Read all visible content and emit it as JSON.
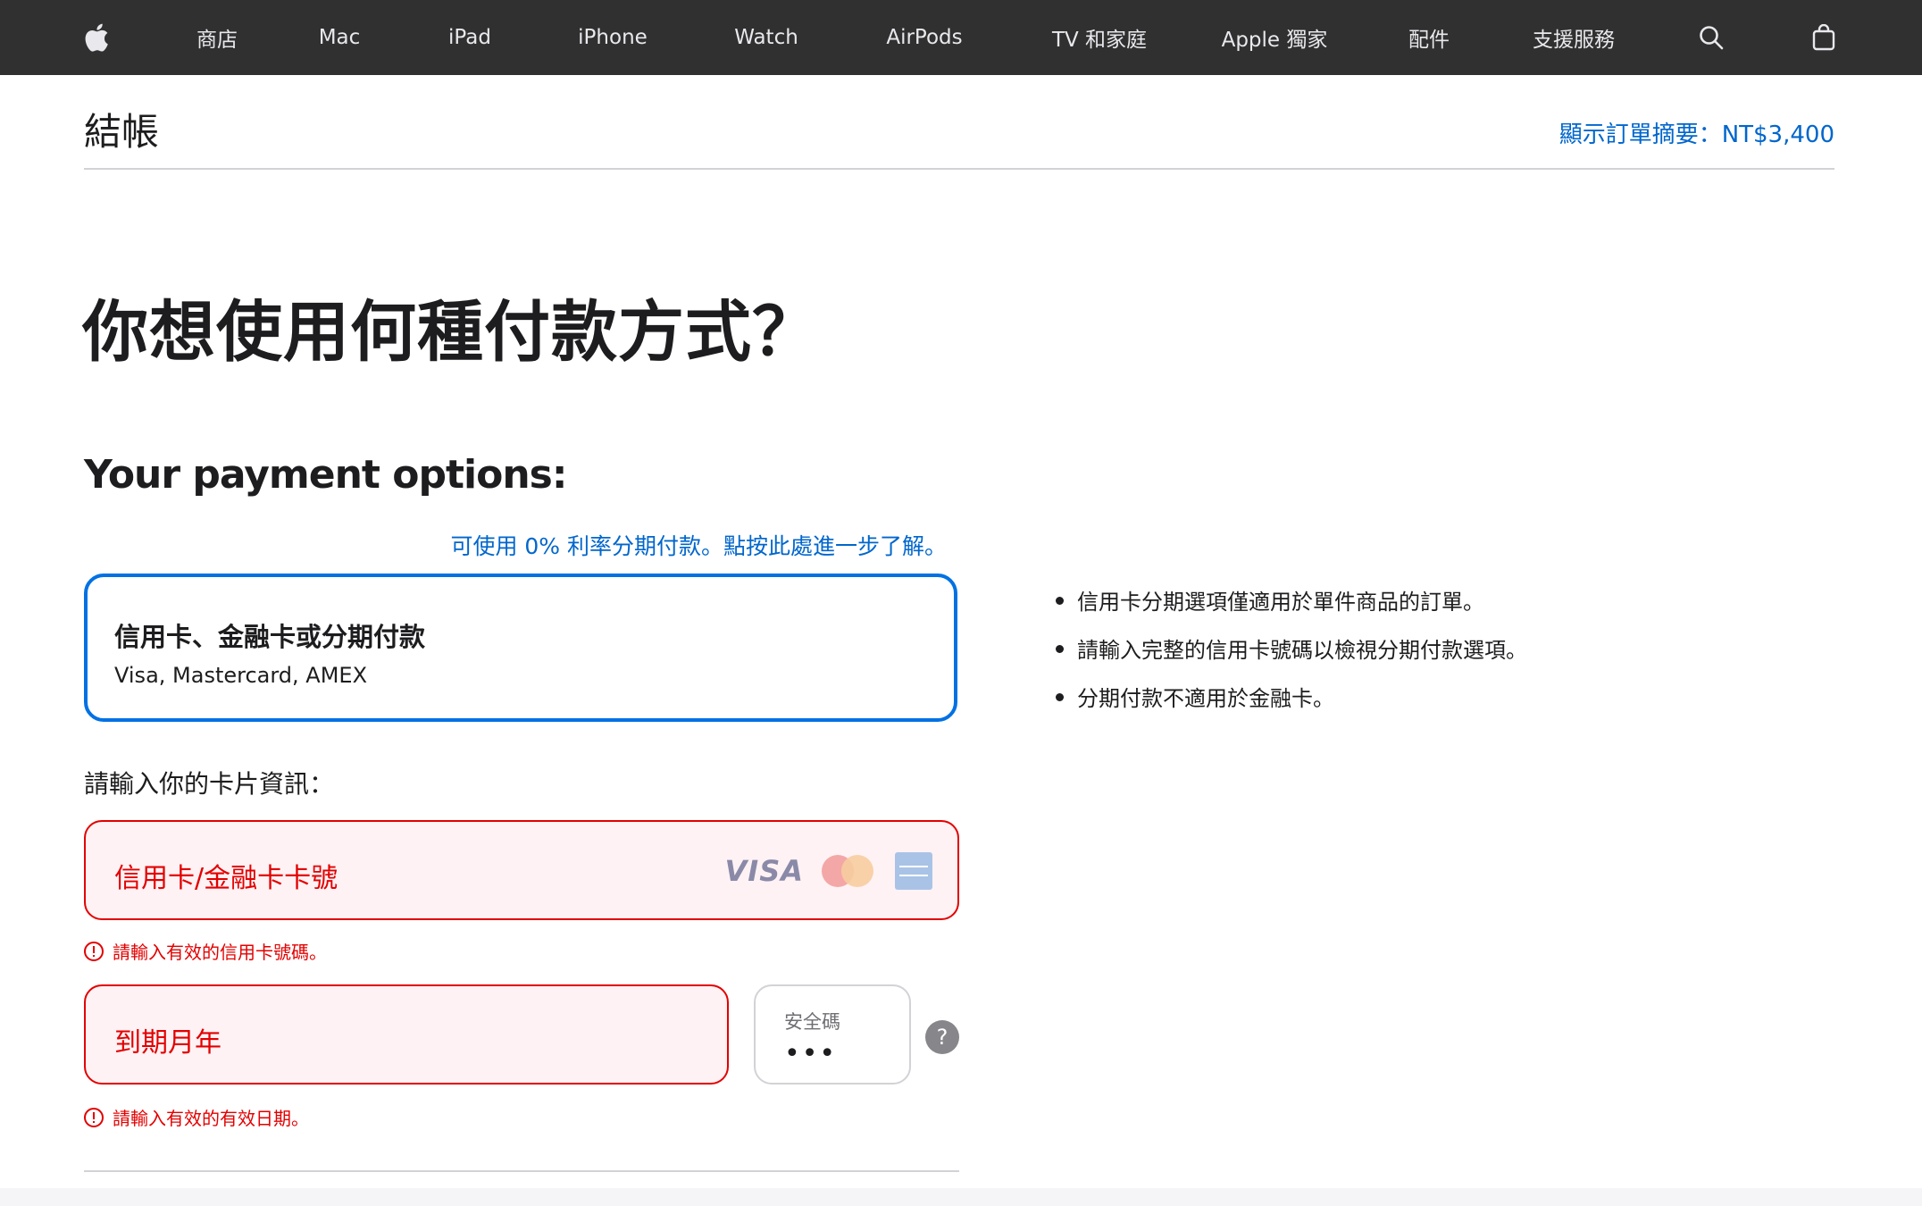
{
  "nav": {
    "items": [
      "商店",
      "Mac",
      "iPad",
      "iPhone",
      "Watch",
      "AirPods",
      "TV 和家庭",
      "Apple 獨家",
      "配件",
      "支援服務"
    ],
    "icons": [
      "apple-logo-icon",
      "search-icon",
      "bag-icon"
    ]
  },
  "header": {
    "title": "結帳",
    "summary_link": "顯示訂單摘要：NT$3,400"
  },
  "main": {
    "heading": "你想使用何種付款方式？",
    "options_heading": "Your payment options:",
    "installment_link": "可使用 0% 利率分期付款。點按此處進一步了解。",
    "payment_option": {
      "title": "信用卡、金融卡或分期付款",
      "subtitle": "Visa, Mastercard, AMEX"
    },
    "info_bullets": [
      "信用卡分期選項僅適用於單件商品的訂單。",
      "請輸入完整的信用卡號碼以檢視分期付款選項。",
      "分期付款不適用於金融卡。"
    ],
    "card_prompt": "請輸入你的卡片資訊：",
    "card_number": {
      "placeholder": "信用卡/金融卡卡號",
      "error": "請輸入有效的信用卡號碼。",
      "brand_visa": "VISA"
    },
    "expiry": {
      "placeholder": "到期月年",
      "error": "請輸入有效的有效日期。"
    },
    "cvv": {
      "label": "安全碼",
      "value": "•••",
      "help": "?"
    }
  },
  "colors": {
    "nav_bg": "#303030",
    "link": "#0066cc",
    "selected_border": "#0071e3",
    "error": "#e30000",
    "error_bg": "#fff2f4"
  }
}
